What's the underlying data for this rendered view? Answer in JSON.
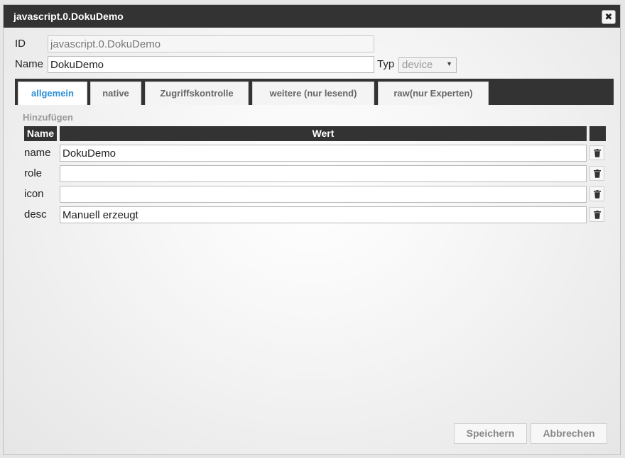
{
  "dialog": {
    "title": "javascript.0.DokuDemo",
    "close_symbol": "✖"
  },
  "form": {
    "id_label": "ID",
    "id_value": "javascript.0.DokuDemo",
    "name_label": "Name",
    "name_value": "DokuDemo",
    "typ_label": "Typ",
    "typ_value": "device"
  },
  "tabs": [
    {
      "label": "allgemein",
      "active": true
    },
    {
      "label": "native"
    },
    {
      "label": "Zugriffskontrolle"
    },
    {
      "label": "weitere (nur lesend)"
    },
    {
      "label": "raw(nur Experten)"
    }
  ],
  "common": {
    "section_label": "Hinzufügen",
    "col_name": "Name",
    "col_value": "Wert",
    "rows": [
      {
        "name": "name",
        "value": "DokuDemo"
      },
      {
        "name": "role",
        "value": ""
      },
      {
        "name": "icon",
        "value": ""
      },
      {
        "name": "desc",
        "value": "Manuell erzeugt"
      }
    ]
  },
  "buttons": {
    "save": "Speichern",
    "cancel": "Abbrechen"
  },
  "colors": {
    "header_bg": "#333333",
    "active_tab": "#2a8fd8"
  }
}
